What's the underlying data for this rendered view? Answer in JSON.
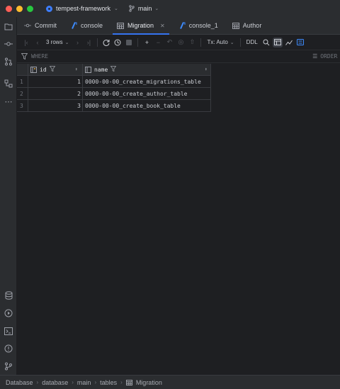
{
  "titlebar": {
    "project": "tempest-framework",
    "branch": "main"
  },
  "tabs": [
    {
      "label": "Commit",
      "icon": "commit-icon",
      "active": false
    },
    {
      "label": "console",
      "icon": "console-icon",
      "active": false
    },
    {
      "label": "Migration",
      "icon": "table-icon",
      "active": true
    },
    {
      "label": "console_1",
      "icon": "console-icon",
      "active": false
    },
    {
      "label": "Author",
      "icon": "table-icon",
      "active": false
    }
  ],
  "toolbar": {
    "rows_label": "3 rows",
    "tx_label": "Tx: Auto",
    "ddl_label": "DDL"
  },
  "filter": {
    "where_label": "WHERE",
    "order_label": "ORDER B"
  },
  "grid": {
    "columns": [
      "id",
      "name"
    ],
    "rows": [
      {
        "num": "1",
        "id": "1",
        "name": "0000-00-00_create_migrations_table"
      },
      {
        "num": "2",
        "id": "2",
        "name": "0000-00-00_create_author_table"
      },
      {
        "num": "3",
        "id": "3",
        "name": "0000-00-00_create_book_table"
      }
    ]
  },
  "statusbar": {
    "breadcrumbs": [
      "Database",
      "database",
      "main",
      "tables",
      "Migration"
    ]
  },
  "colors": {
    "accent": "#3574f0",
    "background": "#1e1f22",
    "panel": "#2b2d30"
  }
}
